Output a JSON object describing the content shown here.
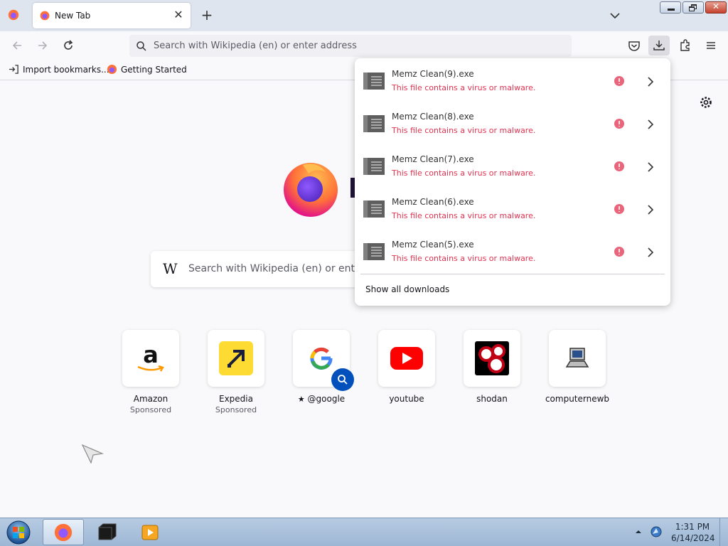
{
  "browser": {
    "tab_title": "New Tab",
    "address_placeholder": "Search with Wikipedia (en) or enter address"
  },
  "bookmarks": [
    {
      "label": "Import bookmarks..."
    },
    {
      "label": "Getting Started"
    }
  ],
  "newtab": {
    "search_prefix": "W",
    "search_placeholder": "Search with Wikipedia (en) or enter address",
    "tiles": [
      {
        "label": "Amazon",
        "sub": "Sponsored",
        "icon": "amazon-icon"
      },
      {
        "label": "Expedia",
        "sub": "Sponsored",
        "icon": "expedia-icon"
      },
      {
        "label": "@google",
        "sub": "",
        "icon": "google-icon"
      },
      {
        "label": "youtube",
        "sub": "",
        "icon": "youtube-icon"
      },
      {
        "label": "shodan",
        "sub": "",
        "icon": "shodan-icon"
      },
      {
        "label": "computernewb",
        "sub": "",
        "icon": "computer-icon"
      }
    ]
  },
  "downloads": {
    "items": [
      {
        "name": "Memz Clean(9).exe",
        "status": "This file contains a virus or malware."
      },
      {
        "name": "Memz Clean(8).exe",
        "status": "This file contains a virus or malware."
      },
      {
        "name": "Memz Clean(7).exe",
        "status": "This file contains a virus or malware."
      },
      {
        "name": "Memz Clean(6).exe",
        "status": "This file contains a virus or malware."
      },
      {
        "name": "Memz Clean(5).exe",
        "status": "This file contains a virus or malware."
      }
    ],
    "show_all_label": "Show all downloads"
  },
  "taskbar": {
    "time": "1:31 PM",
    "date": "6/14/2024"
  },
  "colors": {
    "malware_red": "#e2324f",
    "firefox_orange": "#ff7139",
    "firefox_purple": "#9059ff"
  }
}
